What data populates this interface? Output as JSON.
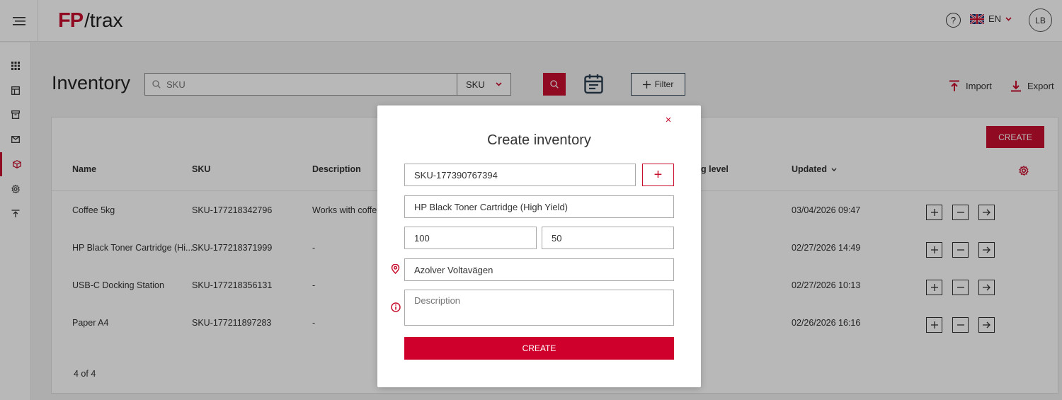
{
  "header": {
    "logo_fp": "FP",
    "logo_trax": "/trax",
    "help": "?",
    "language": "EN",
    "avatar_initials": "LB"
  },
  "page": {
    "title": "Inventory",
    "search_placeholder": "SKU",
    "search_type": "SKU",
    "filter_label": "Filter",
    "import_label": "Import",
    "export_label": "Export",
    "create_label": "CREATE"
  },
  "table": {
    "columns": [
      "Name",
      "SKU",
      "Description",
      "g level",
      "Updated"
    ],
    "rows": [
      {
        "name": "Coffee 5kg",
        "sku": "SKU-177218342796",
        "description": "Works with coffe",
        "updated": "03/04/2026 09:47"
      },
      {
        "name": "HP Black Toner Cartridge (Hi...",
        "sku": "SKU-177218371999",
        "description": "-",
        "updated": "02/27/2026 14:49"
      },
      {
        "name": "USB-C Docking Station",
        "sku": "SKU-177218356131",
        "description": "-",
        "updated": "02/27/2026 10:13"
      },
      {
        "name": "Paper A4",
        "sku": "SKU-177211897283",
        "description": "-",
        "updated": "02/26/2026 16:16"
      }
    ],
    "pager": "4 of 4"
  },
  "modal": {
    "close": "×",
    "title": "Create inventory",
    "sku_value": "SKU-177390767394",
    "plus": "+",
    "name_value": "HP Black Toner Cartridge (High Yield)",
    "quantity_value": "100",
    "min_value": "50",
    "location_value": "Azolver Voltavägen",
    "description_placeholder": "Description",
    "submit_label": "CREATE"
  },
  "colors": {
    "brand_red": "#c8102e",
    "button_red": "#d0002c"
  }
}
